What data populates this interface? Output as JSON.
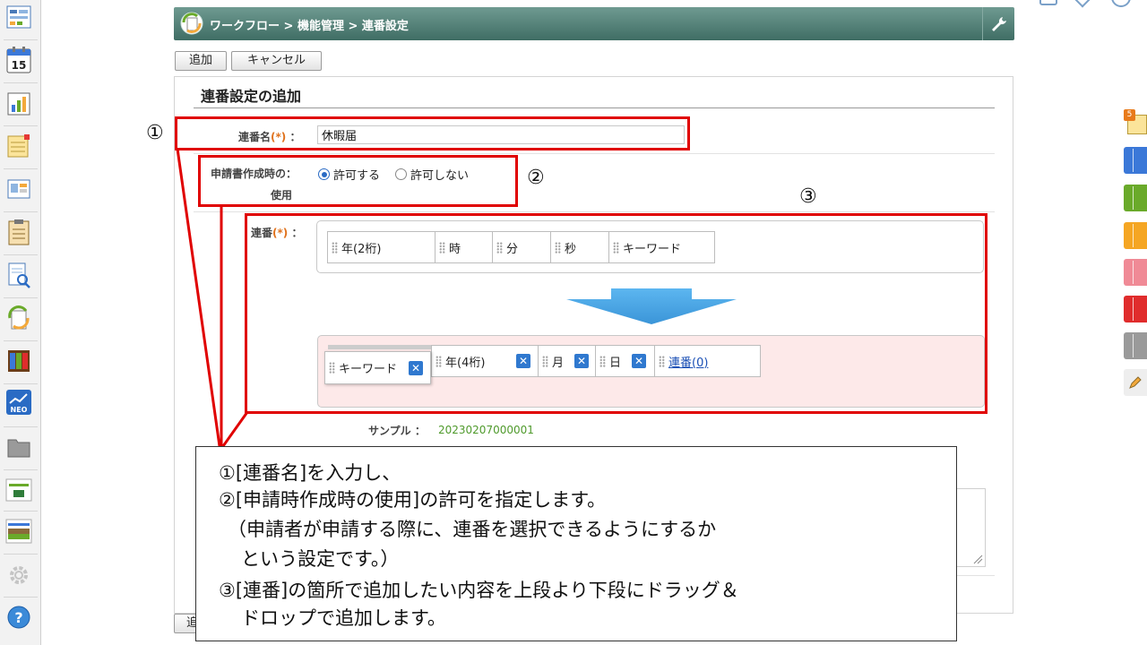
{
  "sidebar_icons": [
    "dashboard-icon",
    "calendar-icon",
    "chart-icon",
    "notes-icon",
    "board-icon",
    "clipboard-icon",
    "search-doc-icon",
    "workflow-icon",
    "binder-icon",
    "neo-icon",
    "folder-icon",
    "app1-icon",
    "app2-icon",
    "settings-icon",
    "help-icon"
  ],
  "calendar_day": "15",
  "neo_label": "NEO",
  "help_label": "?",
  "header": {
    "breadcrumb": "ワークフロー > 機能管理 > 連番設定"
  },
  "buttons": {
    "add": "追加",
    "cancel": "キャンセル",
    "add_bottom": "追"
  },
  "form": {
    "title": "連番設定の追加",
    "name_label": "連番名",
    "required_mark": "(*)",
    "colon": "：",
    "name_value": "休暇届",
    "use_label_line1": "申請書作成時の：",
    "use_label_line2": "使用",
    "radio_allow": "許可する",
    "radio_deny": "許可しない",
    "seq_label": "連番",
    "source_items": [
      "年(2桁)",
      "時",
      "分",
      "秒",
      "キーワード"
    ],
    "target_items": [
      "キーワード",
      "年(4桁)",
      "月",
      "日",
      "連番(0)"
    ],
    "remove_symbol": "✕",
    "sample_label": "サンプル ：",
    "sample_value": "20230207000001"
  },
  "annotations": {
    "markers": [
      "①",
      "②",
      "③"
    ],
    "lines": [
      "①[連番名]を入力し、",
      "②[申請時作成時の使用]の許可を指定します。",
      "（申請者が申請する際に、連番を選択できるようにするか",
      "という設定です。）",
      "③[連番]の箇所で追加したい内容を上段より下段にドラッグ＆",
      "ドロップで追加します。"
    ]
  },
  "right_tab_badge": "5",
  "colors": {
    "header": "#4a7a70",
    "highlight_red": "#e00000",
    "radio_blue": "#2a6bc4",
    "remove_blue": "#2f78cf",
    "arrow_blue": "#4aa8e8",
    "sample_green": "#4f9a2c",
    "target_bg": "#fde9e9",
    "right_tabs": [
      "#3b78d8",
      "#6aaa2a",
      "#f5a623",
      "#f08a96",
      "#e02c2c",
      "#9a9a9a"
    ]
  }
}
